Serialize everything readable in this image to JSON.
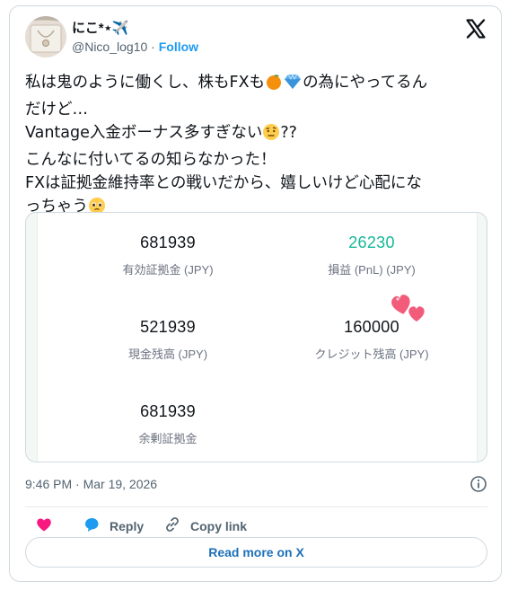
{
  "author": {
    "display_name": "にこ*⋆✈️",
    "handle": "@Nico_log10",
    "separator": "·",
    "follow_label": "Follow",
    "avatar_icon": "profile-photo",
    "platform_icon": "x-logo-icon"
  },
  "tweet": {
    "line1_a": "私は鬼のように働くし、株もFXも",
    "line1_b": "の為にやってるん",
    "line2": "だけど…",
    "line3_a": "Vantage入金ボーナス多すぎない",
    "line3_b": "??",
    "line4": "こんなに付いてるの知らなかった！",
    "line5": "FXは証拠金維持率との戦いだから、嬉しいけど心配にな",
    "line6": "っちゃう",
    "emoji_icons": [
      "tangerine-emoji",
      "gem-emoji",
      "raised-eyebrow-face-emoji",
      "pleading-face-emoji"
    ]
  },
  "media": {
    "metrics": [
      {
        "value": "681939",
        "label": "有効証拠金 (JPY)"
      },
      {
        "value": "26230",
        "label": "損益 (PnL) (JPY)",
        "value_color": "#16b89a"
      },
      {
        "value": "521939",
        "label": "現金残高 (JPY)"
      },
      {
        "value": "160000",
        "label": "クレジット残高 (JPY)"
      },
      {
        "value": "681939",
        "label": "余剰証拠金"
      }
    ],
    "sticker_icon": "two-hearts-sticker"
  },
  "meta": {
    "timestamp": "9:46 PM · Mar 19, 2026",
    "info_icon": "info-icon"
  },
  "actions": {
    "like_icon": "heart-icon",
    "reply_label": "Reply",
    "copy_link_label": "Copy link"
  },
  "read_more_label": "Read more on X",
  "colors": {
    "like": "#f91880",
    "link": "#1d9bf0",
    "pnl_positive": "#16b89a",
    "border": "#cfd9de"
  }
}
